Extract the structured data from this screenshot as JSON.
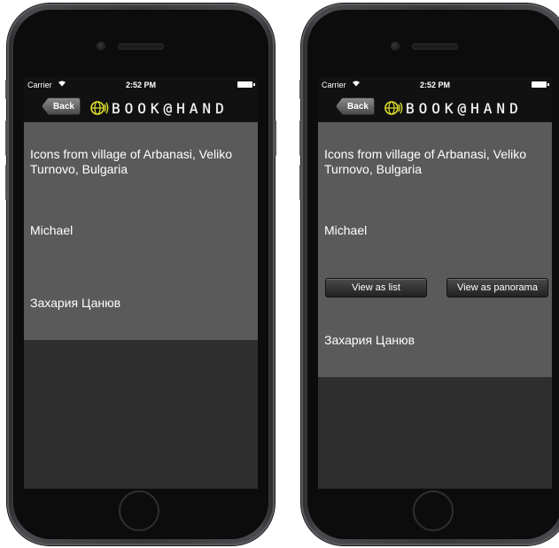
{
  "status_bar": {
    "carrier": "Carrier",
    "wifi_icon": "wifi-icon",
    "time": "2:52 PM",
    "battery_icon": "battery-icon"
  },
  "nav": {
    "back_label": "Back",
    "logo_text": "BOOK@HAND",
    "logo_icon": "globe-sound-icon",
    "logo_color": "#e0e030"
  },
  "items": {
    "title": "Icons from village of Arbanasi, Veliko Turnovo, Bulgaria",
    "name": "Michael",
    "author": "Захария Цанюв"
  },
  "buttons": {
    "view_list": "View as list",
    "view_panorama": "View as panorama"
  },
  "colors": {
    "content_bg": "#5a5a5a",
    "screen_bg": "#2e2e2e",
    "bar_bg": "#111111"
  }
}
